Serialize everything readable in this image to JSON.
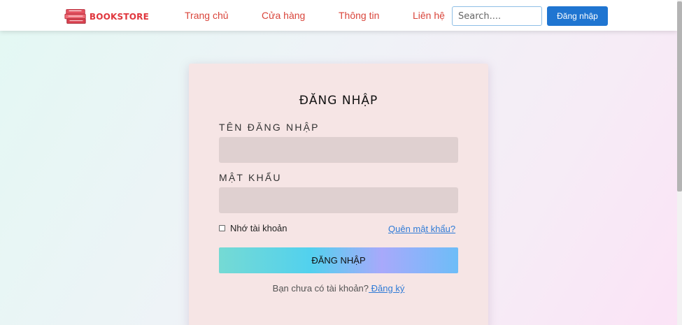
{
  "navbar": {
    "logo_text": "BOOKSTORE",
    "links": [
      "Trang chủ",
      "Cửa hàng",
      "Thông tin",
      "Liên hệ"
    ],
    "search_placeholder": "Search....",
    "login_label": "Đăng nhập",
    "colors": {
      "brand": "#e0363d",
      "link": "#d9453b",
      "button": "#1f75d1"
    }
  },
  "login": {
    "title": "ĐĂNG NHẬP",
    "username_label": "TÊN ĐĂNG NHẬP",
    "password_label": "MẬT KHẨU",
    "remember_label": "Nhớ tài khoản",
    "forgot_label": "Quên mật khẩu?",
    "submit_label": "ĐĂNG NHẬP",
    "register_prompt": "Bạn chưa có tài khoản?",
    "register_label": "Đăng ký"
  }
}
